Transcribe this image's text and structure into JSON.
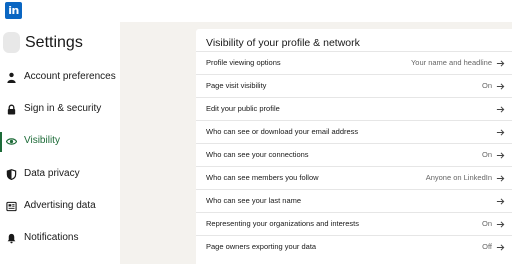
{
  "logo": {
    "text": "in",
    "color": "#0a66c2"
  },
  "sidebar": {
    "title": "Settings",
    "items": [
      {
        "label": "Account preferences",
        "icon": "person-icon",
        "active": false
      },
      {
        "label": "Sign in & security",
        "icon": "lock-icon",
        "active": false
      },
      {
        "label": "Visibility",
        "icon": "eye-icon",
        "active": true
      },
      {
        "label": "Data privacy",
        "icon": "shield-icon",
        "active": false
      },
      {
        "label": "Advertising data",
        "icon": "newspaper-icon",
        "active": false
      },
      {
        "label": "Notifications",
        "icon": "bell-icon",
        "active": false
      }
    ],
    "active_color": "#1d6b38"
  },
  "card": {
    "title": "Visibility of your profile & network",
    "rows": [
      {
        "label": "Profile viewing options",
        "value": "Your name and headline"
      },
      {
        "label": "Page visit visibility",
        "value": "On"
      },
      {
        "label": "Edit your public profile",
        "value": ""
      },
      {
        "label": "Who can see or download your email address",
        "value": ""
      },
      {
        "label": "Who can see your connections",
        "value": "On"
      },
      {
        "label": "Who can see members you follow",
        "value": "Anyone on LinkedIn"
      },
      {
        "label": "Who can see your last name",
        "value": ""
      },
      {
        "label": "Representing your organizations and interests",
        "value": "On"
      },
      {
        "label": "Page owners exporting your data",
        "value": "Off"
      }
    ]
  }
}
